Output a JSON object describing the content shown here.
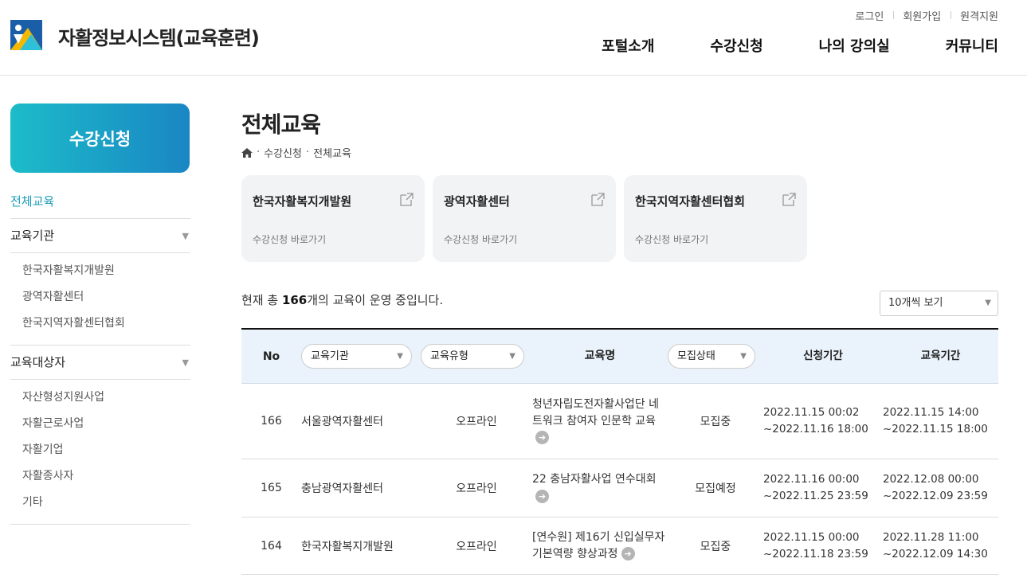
{
  "header": {
    "site_title": "자활정보시스템(교육훈련)",
    "util_links": [
      "로그인",
      "회원가입",
      "원격지원"
    ],
    "gnb": [
      "포털소개",
      "수강신청",
      "나의 강의실",
      "커뮤니티"
    ]
  },
  "sidebar": {
    "title": "수강신청",
    "menu1": "전체교육",
    "menu2": "교육기관",
    "menu2_sub": [
      "한국자활복지개발원",
      "광역자활센터",
      "한국지역자활센터협회"
    ],
    "menu3": "교육대상자",
    "menu3_sub": [
      "자산형성지원사업",
      "자활근로사업",
      "자활기업",
      "자활종사자",
      "기타"
    ]
  },
  "main": {
    "title": "전체교육",
    "breadcrumb": [
      "수강신청",
      "전체교육"
    ],
    "cards": [
      {
        "title": "한국자활복지개발원",
        "link": "수강신청 바로가기"
      },
      {
        "title": "광역자활센터",
        "link": "수강신청 바로가기"
      },
      {
        "title": "한국지역자활센터협회",
        "link": "수강신청 바로가기"
      }
    ],
    "total_prefix": "현재 총 ",
    "total_count": "166",
    "total_suffix": "개의 교육이 운영 중입니다.",
    "per_page": "10개씩 보기"
  },
  "table": {
    "headers": {
      "no": "No",
      "org": "교육기관",
      "type": "교육유형",
      "name": "교육명",
      "state": "모집상태",
      "apply": "신청기간",
      "edu": "교육기간"
    },
    "rows": [
      {
        "no": "166",
        "org": "서울광역자활센터",
        "type": "오프라인",
        "name": "청년자립도전자활사업단 네트워크 참여자 인문학 교육",
        "state": "모집중",
        "apply1": "2022.11.15 00:02",
        "apply2": "~2022.11.16 18:00",
        "edu1": "2022.11.15 14:00",
        "edu2": "~2022.11.15 18:00"
      },
      {
        "no": "165",
        "org": "충남광역자활센터",
        "type": "오프라인",
        "name": "22 충남자활사업 연수대회",
        "state": "모집예정",
        "apply1": "2022.11.16 00:00",
        "apply2": "~2022.11.25 23:59",
        "edu1": "2022.12.08 00:00",
        "edu2": "~2022.12.09 23:59"
      },
      {
        "no": "164",
        "org": "한국자활복지개발원",
        "type": "오프라인",
        "name": "[연수원] 제16기 신입실무자 기본역량 향상과정",
        "state": "모집중",
        "apply1": "2022.11.15 00:00",
        "apply2": "~2022.11.18 23:59",
        "edu1": "2022.11.28 11:00",
        "edu2": "~2022.12.09 14:30"
      }
    ]
  }
}
